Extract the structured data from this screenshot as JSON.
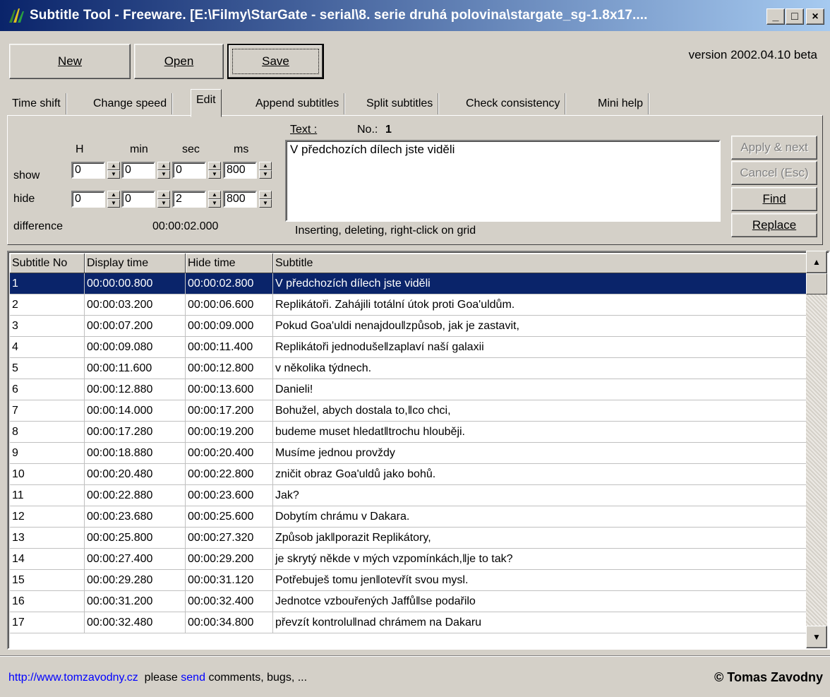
{
  "window": {
    "title": "Subtitle Tool - Freeware. [E:\\Filmy\\StarGate - serial\\8. serie druhá polovina\\stargate_sg-1.8x17....",
    "minimize": "_",
    "maximize": "□",
    "close": "×"
  },
  "toolbar": {
    "new_label": "New",
    "open_label": "Open",
    "save_label": "Save"
  },
  "version": "version  2002.04.10 beta",
  "tabs": [
    "Time shift",
    "Change speed",
    "Edit",
    "Append subtitles",
    "Split subtitles",
    "Check consistency",
    "Mini help"
  ],
  "active_tab": "Edit",
  "edit": {
    "col_h": "H",
    "col_min": "min",
    "col_sec": "sec",
    "col_ms": "ms",
    "show_label": "show",
    "hide_label": "hide",
    "show": {
      "h": "0",
      "min": "0",
      "sec": "0",
      "ms": "800"
    },
    "hide": {
      "h": "0",
      "min": "0",
      "sec": "2",
      "ms": "800"
    },
    "difference_label": "difference",
    "difference_value": "00:00:02.000",
    "text_label": "Text :",
    "no_label": "No.:",
    "no_value": "1",
    "text_value": "V předchozích dílech jste viděli",
    "hint": "Inserting, deleting, right-click on grid",
    "apply_next": "Apply & next",
    "cancel": "Cancel (Esc)",
    "find": "Find",
    "replace": "Replace"
  },
  "grid": {
    "headers": [
      "Subtitle No",
      "Display time",
      "Hide time",
      "Subtitle"
    ],
    "selected_row": 0,
    "rows": [
      [
        "1",
        "00:00:00.800",
        "00:00:02.800",
        "V předchozích dílech jste viděli"
      ],
      [
        "2",
        "00:00:03.200",
        "00:00:06.600",
        "Replikátoři. Zahájili totální útok proti Goa'uldům."
      ],
      [
        "3",
        "00:00:07.200",
        "00:00:09.000",
        " Pokud Goa'uldi nenajdou‖způsob, jak je zastavit,"
      ],
      [
        "4",
        "00:00:09.080",
        "00:00:11.400",
        "Replikátoři jednoduše‖zaplaví naší galaxii"
      ],
      [
        "5",
        "00:00:11.600",
        "00:00:12.800",
        "v několika týdnech."
      ],
      [
        "6",
        "00:00:12.880",
        "00:00:13.600",
        "Danieli!"
      ],
      [
        "7",
        "00:00:14.000",
        "00:00:17.200",
        "Bohužel, abych dostala to,‖co chci,"
      ],
      [
        "8",
        "00:00:17.280",
        "00:00:19.200",
        "budeme muset hledat‖trochu hlouběji."
      ],
      [
        "9",
        "00:00:18.880",
        "00:00:20.400",
        "Musíme jednou provždy"
      ],
      [
        "10",
        "00:00:20.480",
        "00:00:22.800",
        "zničit obraz Goa'uldů jako bohů."
      ],
      [
        "11",
        "00:00:22.880",
        "00:00:23.600",
        "Jak?"
      ],
      [
        "12",
        "00:00:23.680",
        "00:00:25.600",
        "Dobytím chrámu v Dakara."
      ],
      [
        "13",
        "00:00:25.800",
        "00:00:27.320",
        "Způsob jak‖porazit Replikátory,"
      ],
      [
        "14",
        "00:00:27.400",
        "00:00:29.200",
        "je skrytý někde v mých vzpomínkách,‖je to tak?"
      ],
      [
        "15",
        "00:00:29.280",
        "00:00:31.120",
        "Potřebuješ tomu jen‖otevřít svou mysl."
      ],
      [
        "16",
        "00:00:31.200",
        "00:00:32.400",
        "Jednotce vzbouřených Jaffů‖se podařilo"
      ],
      [
        "17",
        "00:00:32.480",
        "00:00:34.800",
        "převzít kontrolu‖nad chrámem na Dakaru"
      ]
    ]
  },
  "status": {
    "url": "http://www.tomzavodny.cz",
    "please": "please",
    "send": "send",
    "rest": "comments, bugs, ...",
    "copyright": "© Tomas Zavodny"
  }
}
